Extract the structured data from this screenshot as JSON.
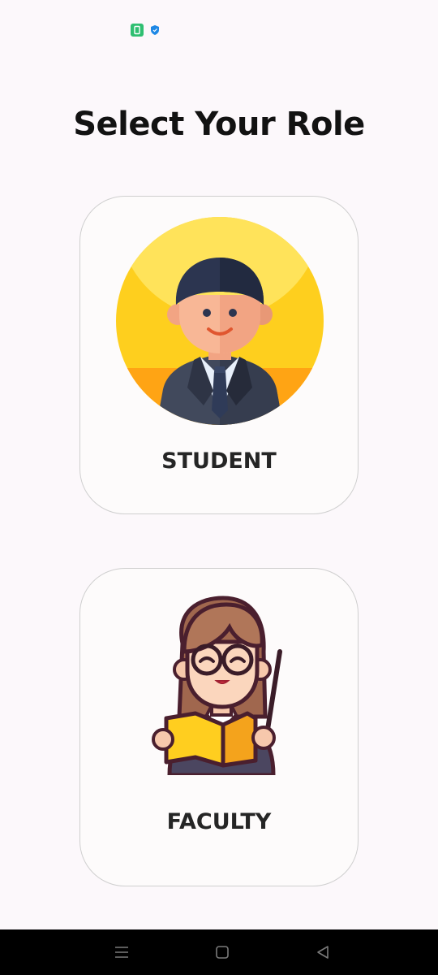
{
  "screen": {
    "title": "Select Your Role"
  },
  "roles": [
    {
      "label": "STUDENT",
      "icon": "student-avatar-icon"
    },
    {
      "label": "FACULTY",
      "icon": "teacher-avatar-icon"
    }
  ],
  "status_bar": {
    "icons": [
      "app-notification-icon",
      "shield-icon"
    ]
  },
  "navigation_bar": {
    "buttons": [
      "recents-button",
      "home-button",
      "back-button"
    ]
  },
  "colors": {
    "background": "#fcf8fb",
    "card_border": "#cfcfcf",
    "nav_bar": "#000000"
  }
}
